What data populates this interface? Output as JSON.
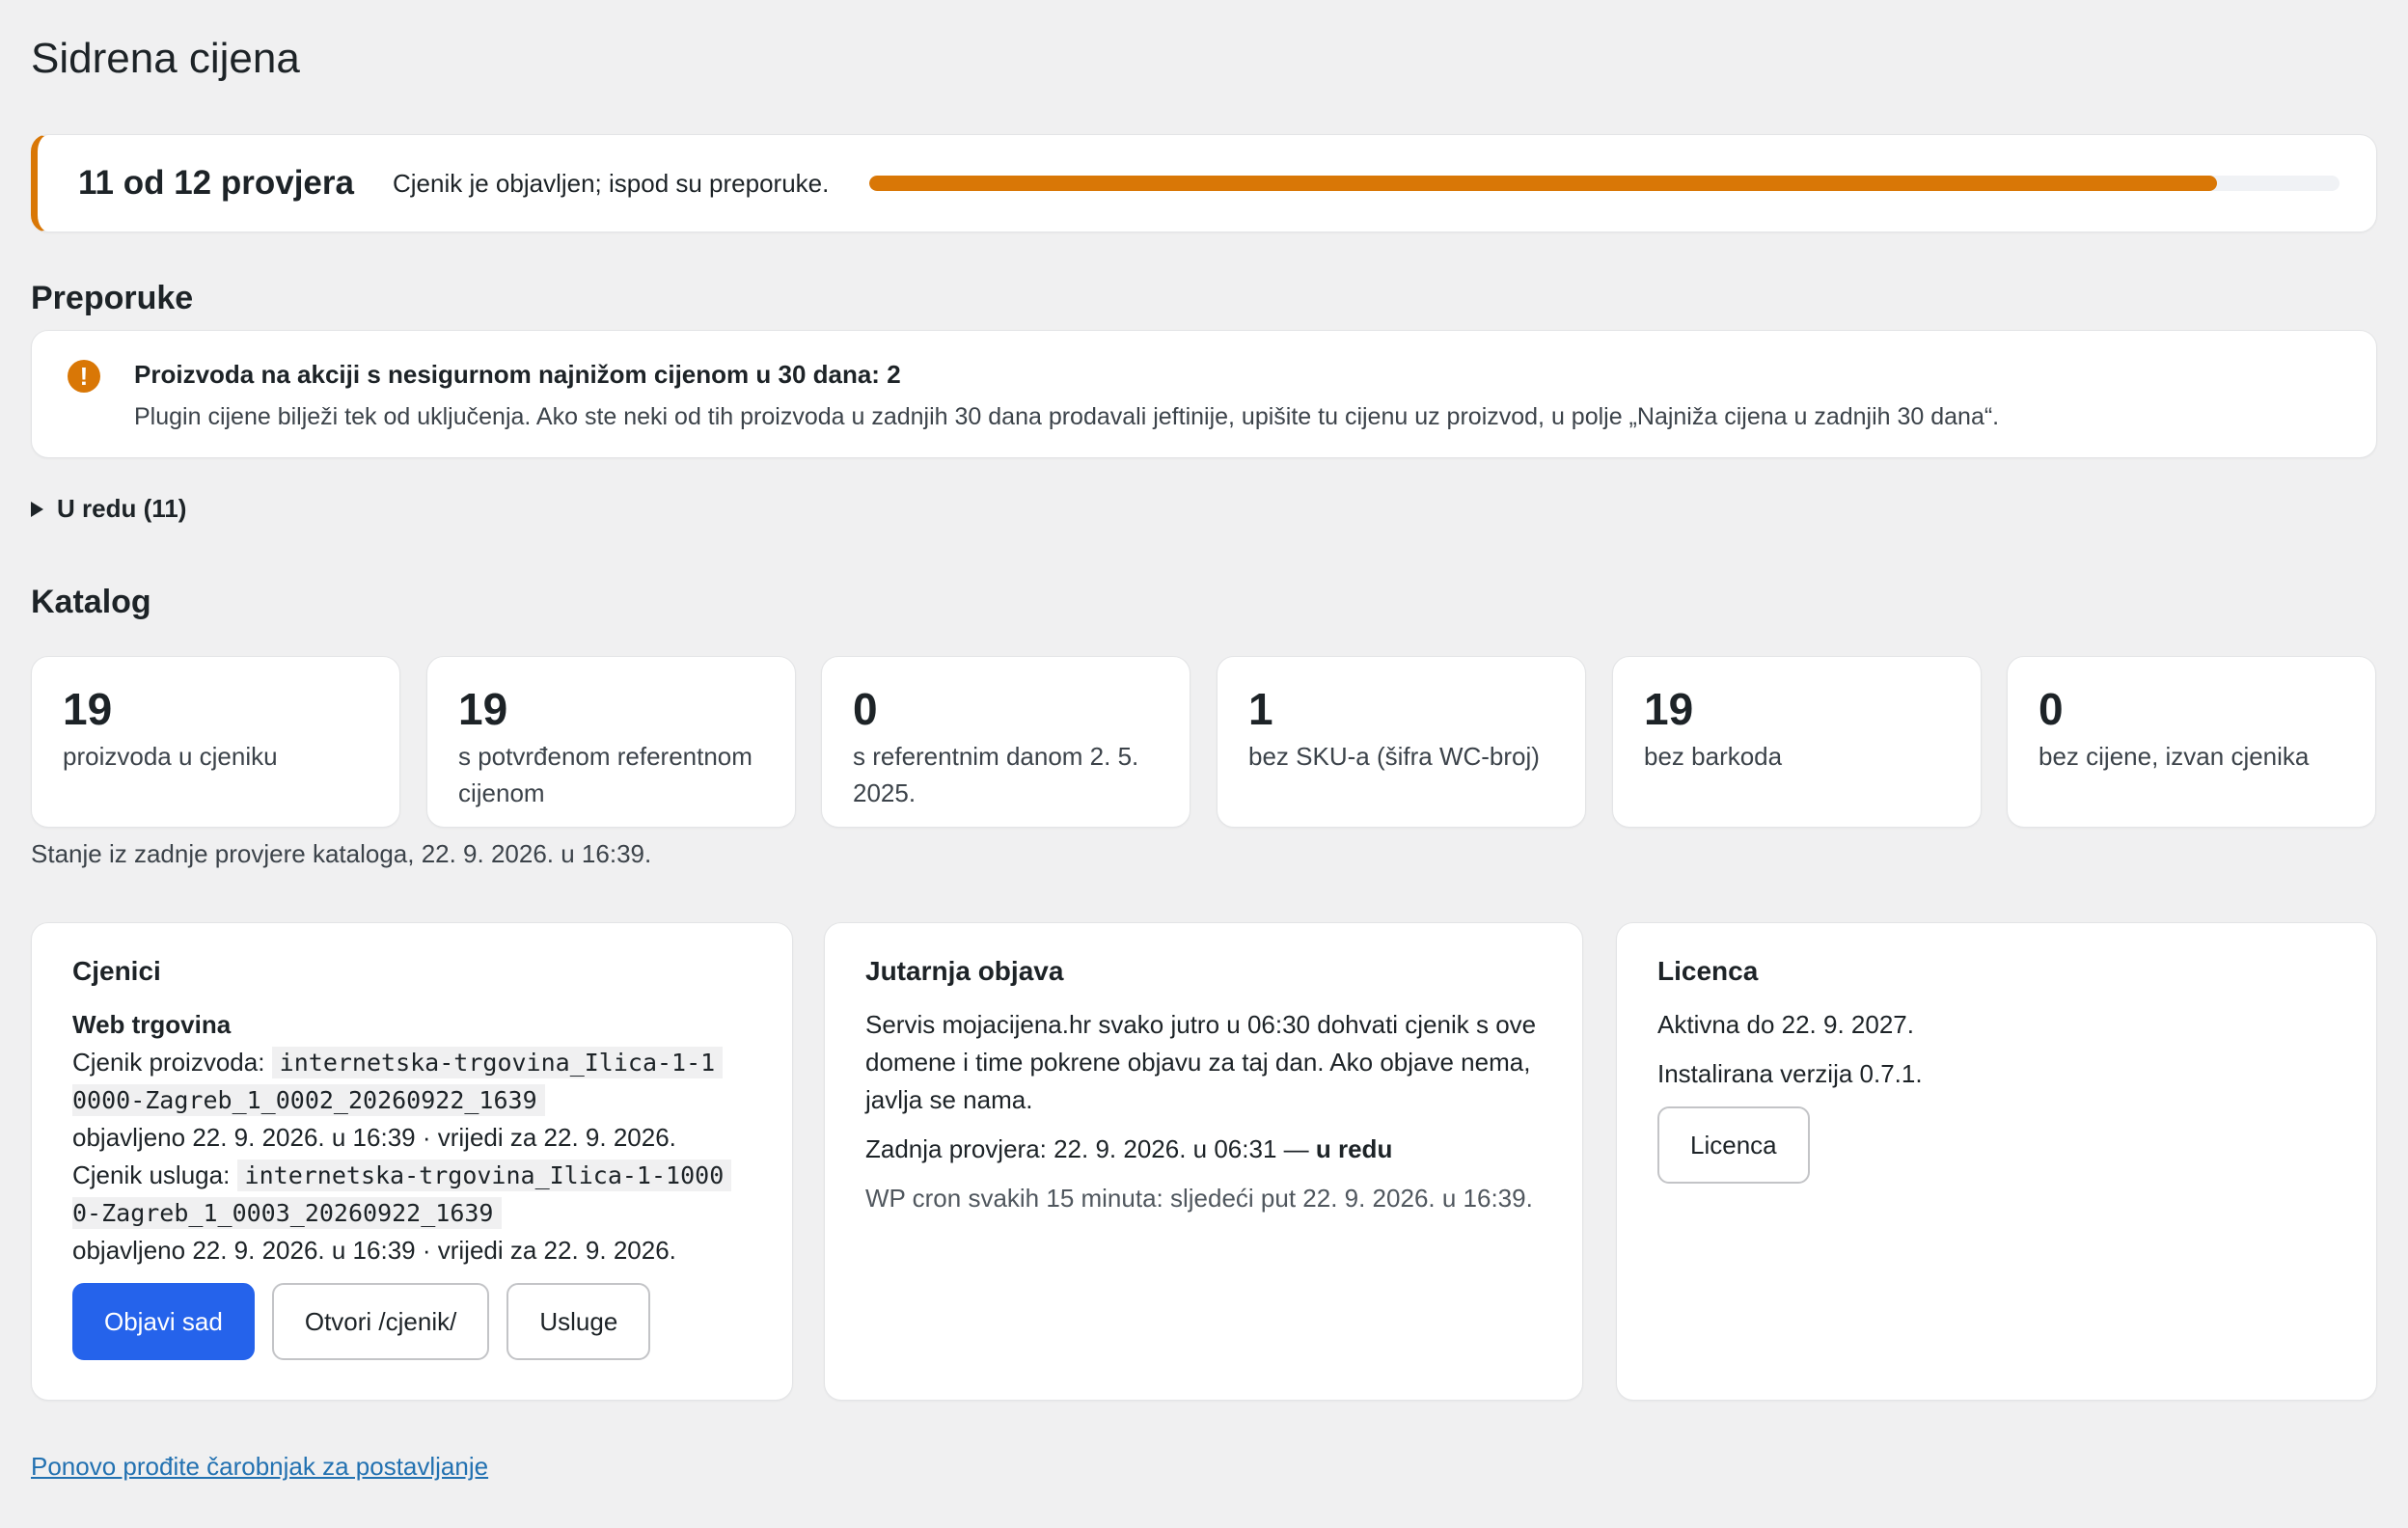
{
  "page": {
    "title": "Sidrena cijena"
  },
  "progress": {
    "count_label": "11 od 12 provjera",
    "message": "Cjenik je objavljen; ispod su preporuke.",
    "passed": 11,
    "total": 12,
    "accent_color": "#d97706"
  },
  "recommendations": {
    "heading": "Preporuke",
    "items": [
      {
        "icon": "warning-icon",
        "title": "Proizvoda na akciji s nesigurnom najnižom cijenom u 30 dana: 2",
        "description": "Plugin cijene bilježi tek od uključenja. Ako ste neki od tih proizvoda u zadnjih 30 dana prodavali jeftinije, upišite tu cijenu uz proizvod, u polje „Najniža cijena u zadnjih 30 dana“."
      }
    ],
    "ok_toggle": "U redu (11)"
  },
  "catalog": {
    "heading": "Katalog",
    "stats": [
      {
        "value": "19",
        "label": "proizvoda u cjeniku"
      },
      {
        "value": "19",
        "label": "s potvrđenom referentnom cijenom"
      },
      {
        "value": "0",
        "label": "s referentnim danom 2. 5. 2025."
      },
      {
        "value": "1",
        "label": "bez SKU-a (šifra WC-broj)"
      },
      {
        "value": "19",
        "label": "bez barkoda"
      },
      {
        "value": "0",
        "label": "bez cijene, izvan cjenika"
      }
    ],
    "note": "Stanje iz zadnje provjere kataloga, 22. 9. 2026. u 16:39."
  },
  "cjenici": {
    "title": "Cjenici",
    "subtitle": "Web trgovina",
    "products_label": "Cjenik proizvoda:",
    "products_file_a": "internetska-trgovina_Ilica-1-1",
    "products_file_b": "0000-Zagreb_1_0002_20260922_1639",
    "products_meta": "objavljeno 22. 9. 2026. u 16:39 · vrijedi za 22. 9. 2026.",
    "services_label": "Cjenik usluga:",
    "services_file_a": "internetska-trgovina_Ilica-1-1000",
    "services_file_b": "0-Zagreb_1_0003_20260922_1639",
    "services_meta": "objavljeno 22. 9. 2026. u 16:39 · vrijedi za 22. 9. 2026.",
    "buttons": {
      "publish": "Objavi sad",
      "open": "Otvori /cjenik/",
      "services": "Usluge"
    }
  },
  "morning": {
    "title": "Jutarnja objava",
    "body": "Servis mojacijena.hr svako jutro u 06:30 dohvati cjenik s ove domene i time pokrene objavu za taj dan. Ako objave nema, javlja se nama.",
    "last_check": "Zadnja provjera: 22. 9. 2026. u 06:31 —",
    "last_status": "u redu",
    "cron": "WP cron svakih 15 minuta: sljedeći put 22. 9. 2026. u 16:39."
  },
  "license": {
    "title": "Licenca",
    "active": "Aktivna do 22. 9. 2027.",
    "version": "Instalirana verzija 0.7.1.",
    "button": "Licenca"
  },
  "footer": {
    "link": "Ponovo prođite čarobnjak za postavljanje"
  }
}
